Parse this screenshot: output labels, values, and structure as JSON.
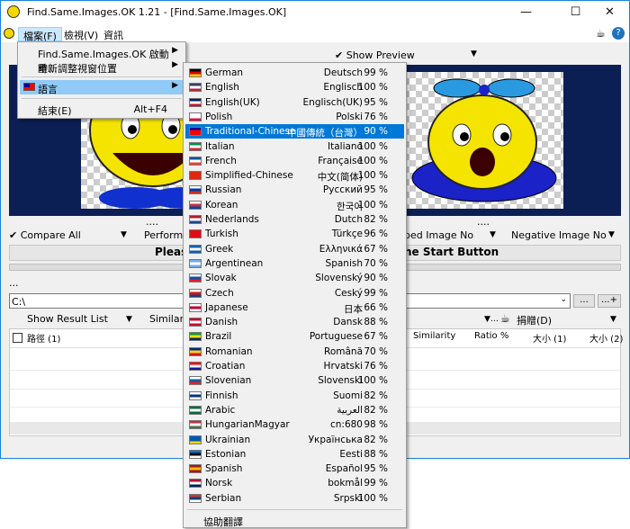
{
  "window": {
    "title": "Find.Same.Images.OK 1.21 - [Find.Same.Images.OK]"
  },
  "menubar": {
    "items": [
      "檔案(F)",
      "檢視(V)",
      "資訊"
    ]
  },
  "file_menu": {
    "items": [
      {
        "label": "Find.Same.Images.OK 啟動時...",
        "has_sub": true
      },
      {
        "label": "重新調整視窗位置",
        "has_sub": true
      },
      {
        "label": "語言",
        "has_sub": true,
        "highlighted": true
      },
      {
        "label": "結束(E)",
        "shortcut": "Alt+F4"
      }
    ]
  },
  "preview": {
    "show_preview": "Show Preview",
    "dots": "....",
    "dots_left": "..."
  },
  "compare": {
    "compare_all": "Compare All",
    "performa": "Performa",
    "right_label_1": "ped Image No",
    "negative": "Negative Image No"
  },
  "start_banner": {
    "left": "Pleas",
    "right": "he Start Button"
  },
  "path": {
    "value": "C:\\",
    "btn1": "...",
    "btn2": "...+"
  },
  "result": {
    "show_result_list": "Show Result List",
    "similarit": "Similarit",
    "donate": "捐贈(D)",
    "columns": {
      "path": "路徑 (1)",
      "similarity": "Similarity",
      "ratio": "Ratio %",
      "size1": "大小 (1)",
      "size2": "大小 (2)"
    }
  },
  "languages": [
    {
      "name": "German",
      "native": "Deutsch",
      "pct": "99 %",
      "flag": [
        "#000000",
        "#dd0000",
        "#ffce00"
      ]
    },
    {
      "name": "English",
      "native": "Englisch",
      "pct": "100 %",
      "flag": [
        "#3c3b6e",
        "#ffffff",
        "#b22234"
      ]
    },
    {
      "name": "English(UK)",
      "native": "Englisch(UK)",
      "pct": "95 %",
      "flag": [
        "#012169",
        "#ffffff",
        "#c8102e"
      ]
    },
    {
      "name": "Polish",
      "native": "Polski",
      "pct": "76 %",
      "flag": [
        "#ffffff",
        "#ffffff",
        "#dc143c"
      ]
    },
    {
      "name": "Traditional-Chinese",
      "native": "中國傳統（台灣）",
      "pct": "90 %",
      "flag": [
        "#000095",
        "#fe0000",
        "#fe0000"
      ],
      "selected": true
    },
    {
      "name": "Italian",
      "native": "Italiano",
      "pct": "100 %",
      "flag": [
        "#009246",
        "#ffffff",
        "#ce2b37"
      ]
    },
    {
      "name": "French",
      "native": "Française",
      "pct": "100 %",
      "flag": [
        "#0055a4",
        "#ffffff",
        "#ef4135"
      ]
    },
    {
      "name": "Simplified-Chinese",
      "native": "中文(简体)",
      "pct": "100 %",
      "flag": [
        "#de2910",
        "#de2910",
        "#de2910"
      ]
    },
    {
      "name": "Russian",
      "native": "Русский",
      "pct": "95 %",
      "flag": [
        "#ffffff",
        "#0039a6",
        "#d52b1e"
      ]
    },
    {
      "name": "Korean",
      "native": "한국어",
      "pct": "100 %",
      "flag": [
        "#ffffff",
        "#cd2e3a",
        "#0047a0"
      ]
    },
    {
      "name": "Nederlands",
      "native": "Dutch",
      "pct": "82 %",
      "flag": [
        "#ae1c28",
        "#ffffff",
        "#21468b"
      ]
    },
    {
      "name": "Turkish",
      "native": "Türkçe",
      "pct": "96 %",
      "flag": [
        "#e30a17",
        "#e30a17",
        "#e30a17"
      ]
    },
    {
      "name": "Greek",
      "native": "Ελληνικά",
      "pct": "67 %",
      "flag": [
        "#0d5eaf",
        "#ffffff",
        "#0d5eaf"
      ]
    },
    {
      "name": "Argentinean",
      "native": "Spanish",
      "pct": "70 %",
      "flag": [
        "#74acdf",
        "#ffffff",
        "#74acdf"
      ]
    },
    {
      "name": "Slovak",
      "native": "Slovenský",
      "pct": "90 %",
      "flag": [
        "#ffffff",
        "#0b4ea2",
        "#ee1c25"
      ]
    },
    {
      "name": "Czech",
      "native": "Ceský",
      "pct": "99 %",
      "flag": [
        "#ffffff",
        "#d7141a",
        "#11457e"
      ]
    },
    {
      "name": "Japanese",
      "native": "日本",
      "pct": "66 %",
      "flag": [
        "#ffffff",
        "#bc002d",
        "#ffffff"
      ]
    },
    {
      "name": "Danish",
      "native": "Dansk",
      "pct": "88 %",
      "flag": [
        "#c60c30",
        "#ffffff",
        "#c60c30"
      ]
    },
    {
      "name": "Brazil",
      "native": "Portuguese",
      "pct": "67 %",
      "flag": [
        "#009c3b",
        "#ffdf00",
        "#002776"
      ]
    },
    {
      "name": "Romanian",
      "native": "Română",
      "pct": "70 %",
      "flag": [
        "#002b7f",
        "#fcd116",
        "#ce1126"
      ]
    },
    {
      "name": "Croatian",
      "native": "Hrvatski",
      "pct": "76 %",
      "flag": [
        "#ff0000",
        "#ffffff",
        "#171796"
      ]
    },
    {
      "name": "Slovenian",
      "native": "Slovenski",
      "pct": "100 %",
      "flag": [
        "#ffffff",
        "#005da4",
        "#ed1c24"
      ]
    },
    {
      "name": "Finnish",
      "native": "Suomi",
      "pct": "82 %",
      "flag": [
        "#ffffff",
        "#003580",
        "#ffffff"
      ]
    },
    {
      "name": "Arabic",
      "native": "العربية",
      "pct": "82 %",
      "flag": [
        "#006c35",
        "#ffffff",
        "#006c35"
      ]
    },
    {
      "name": "HungarianMagyar",
      "native": "cn:680",
      "pct": "98 %",
      "flag": [
        "#ce2939",
        "#ffffff",
        "#477050"
      ]
    },
    {
      "name": "Ukrainian",
      "native": "Українська",
      "pct": "82 %",
      "flag": [
        "#0057b7",
        "#0057b7",
        "#ffd700"
      ]
    },
    {
      "name": "Estonian",
      "native": "Eesti",
      "pct": "88 %",
      "flag": [
        "#0072ce",
        "#000000",
        "#ffffff"
      ]
    },
    {
      "name": "Spanish",
      "native": "Español",
      "pct": "95 %",
      "flag": [
        "#aa151b",
        "#f1bf00",
        "#aa151b"
      ]
    },
    {
      "name": "Norsk",
      "native": "bokmål",
      "pct": "99 %",
      "flag": [
        "#ba0c2f",
        "#ffffff",
        "#00205b"
      ]
    },
    {
      "name": "Serbian",
      "native": "Srpski",
      "pct": "100 %",
      "flag": [
        "#c6363c",
        "#0c4076",
        "#ffffff"
      ]
    }
  ],
  "help_translate": "協助翻譯"
}
